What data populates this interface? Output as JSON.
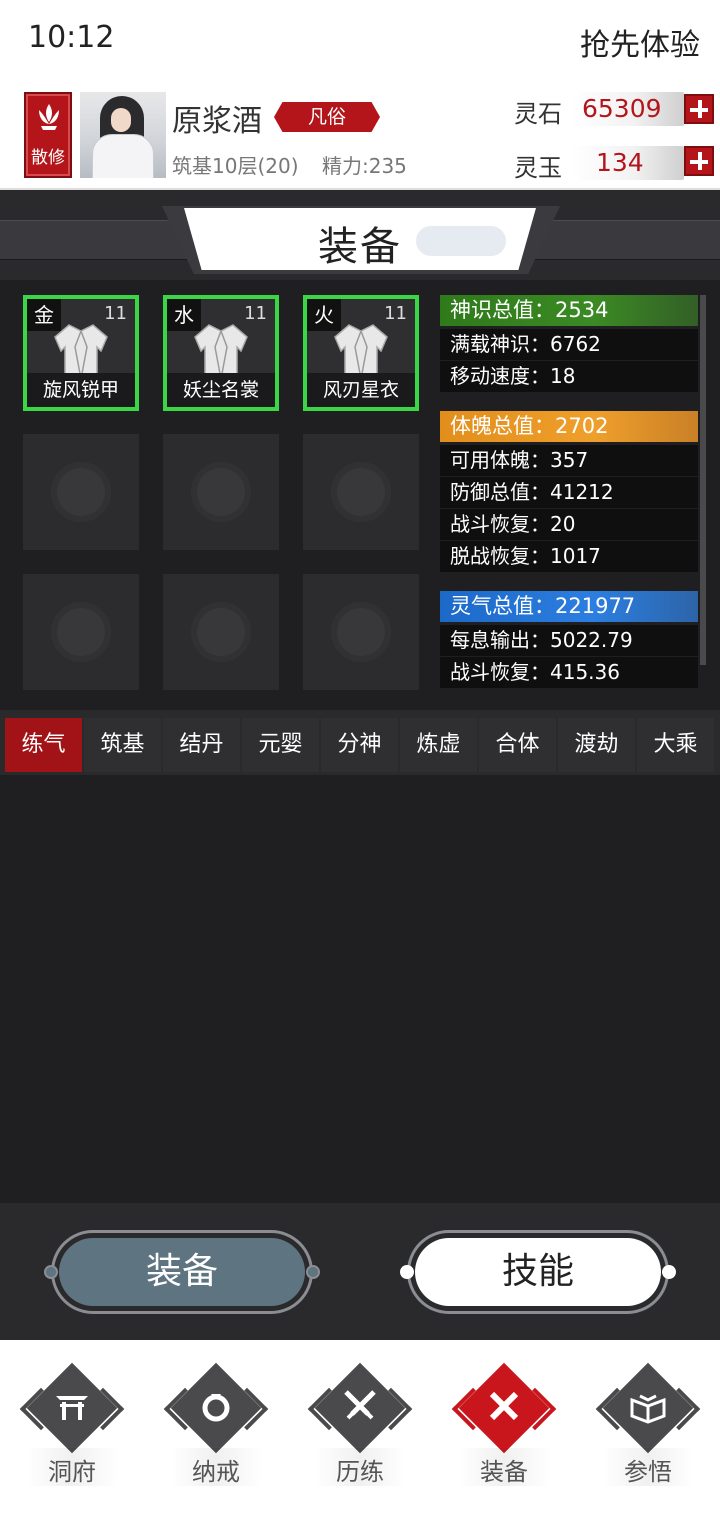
{
  "status": {
    "time": "10:12",
    "promo": "抢先体验"
  },
  "player": {
    "sect": "散修",
    "name": "原浆酒",
    "rank": "凡俗",
    "realm": "筑基10层(20)",
    "energy": "精力:235"
  },
  "currency": {
    "stone_label": "灵石",
    "stone_value": "65309",
    "jade_label": "灵玉",
    "jade_value": "134"
  },
  "page_title": "装备",
  "equipment": [
    {
      "element": "金",
      "level": "11",
      "name": "旋风锐甲"
    },
    {
      "element": "水",
      "level": "11",
      "name": "妖尘名裳"
    },
    {
      "element": "火",
      "level": "11",
      "name": "风刃星衣"
    }
  ],
  "stats": {
    "soul_total": "神识总值：2534",
    "full_soul": "满载神识：6762",
    "move_speed": "移动速度：18",
    "body_total": "体魄总值：2702",
    "usable_body": "可用体魄：357",
    "defense_total": "防御总值：41212",
    "battle_recover": "战斗恢复：20",
    "rest_recover": "脱战恢复：1017",
    "qi_total": "灵气总值：221977",
    "output_per_breath": "每息输出：5022.79",
    "qi_battle_recover": "战斗恢复：415.36"
  },
  "tabs": [
    "练气",
    "筑基",
    "结丹",
    "元婴",
    "分神",
    "炼虚",
    "合体",
    "渡劫",
    "大乘"
  ],
  "buttons": {
    "equip": "装备",
    "skill": "技能"
  },
  "nav": [
    "洞府",
    "纳戒",
    "历练",
    "装备",
    "参悟"
  ],
  "colors": {
    "accent_red": "#b4151a",
    "equipped_border": "#3bd646"
  }
}
